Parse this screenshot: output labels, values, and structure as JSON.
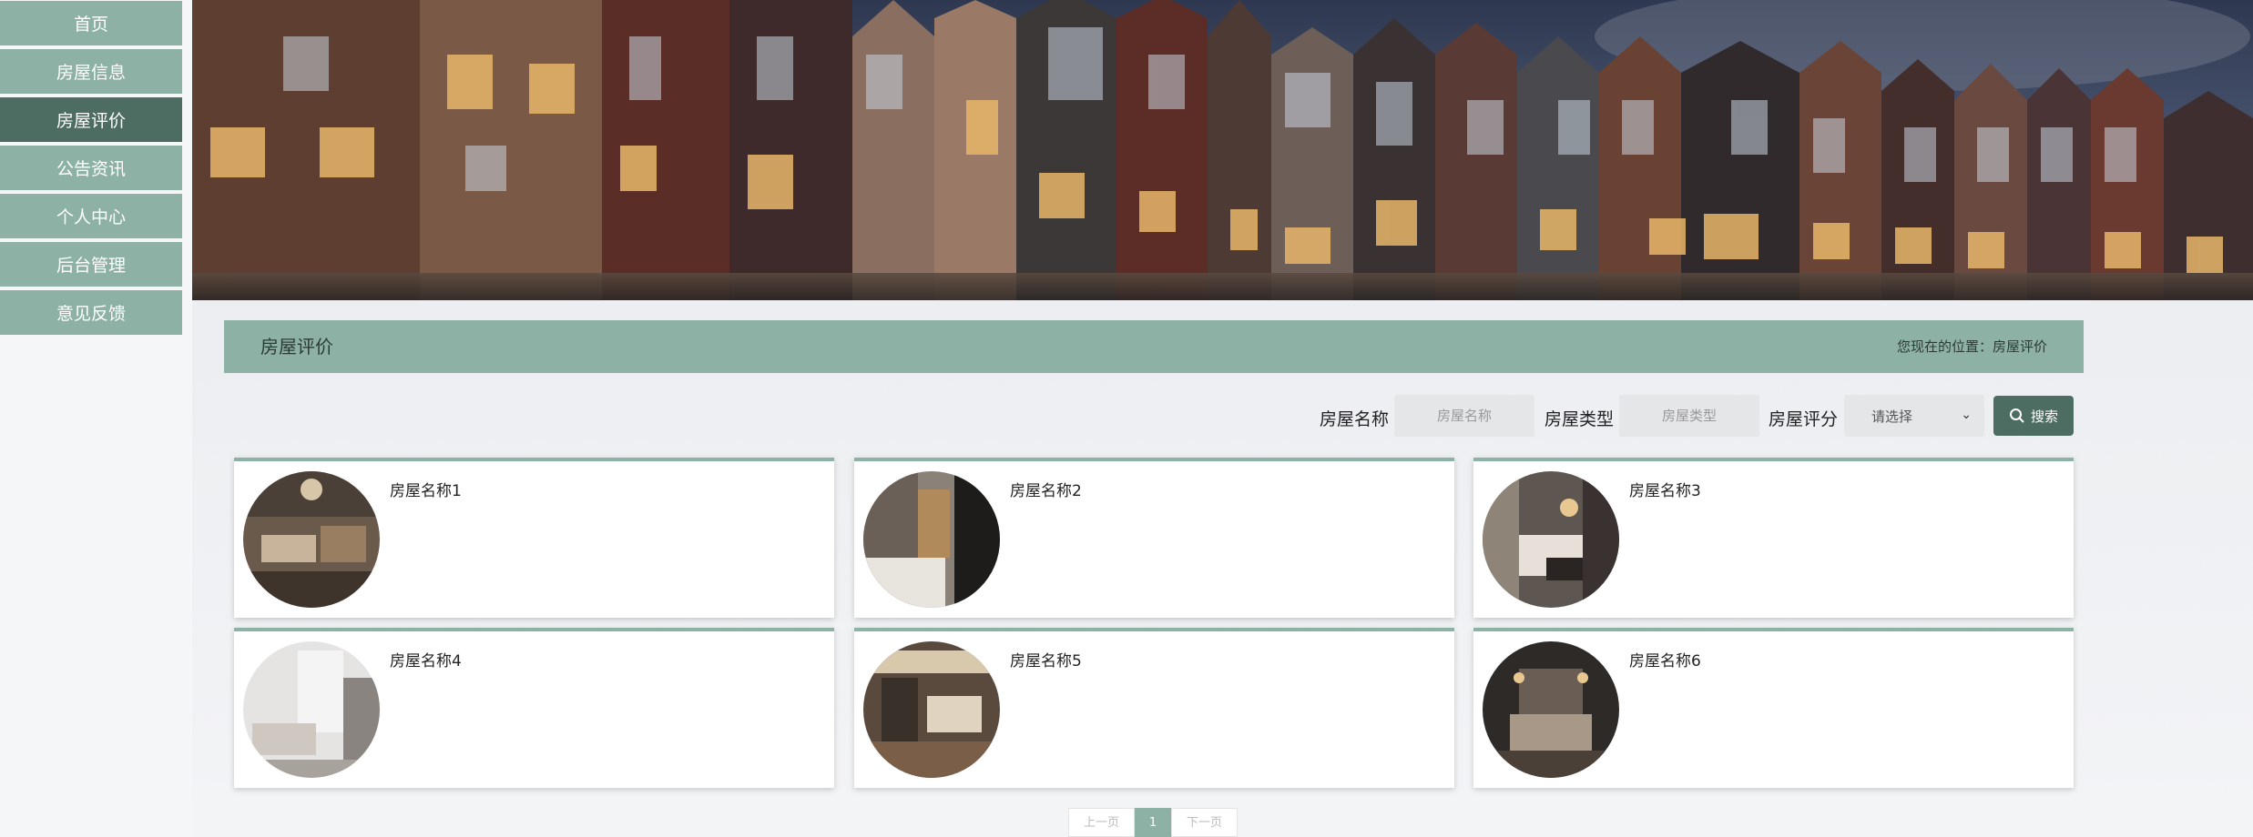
{
  "sidebar": {
    "items": [
      {
        "label": "首页"
      },
      {
        "label": "房屋信息"
      },
      {
        "label": "房屋评价",
        "active": true
      },
      {
        "label": "公告资讯"
      },
      {
        "label": "个人中心"
      },
      {
        "label": "后台管理"
      },
      {
        "label": "意见反馈"
      }
    ]
  },
  "header": {
    "title": "房屋评价",
    "location": "您现在的位置：房屋评价"
  },
  "search": {
    "name_label": "房屋名称",
    "name_placeholder": "房屋名称",
    "type_label": "房屋类型",
    "type_placeholder": "房屋类型",
    "rating_label": "房屋评分",
    "rating_selected": "请选择",
    "button_label": "搜索"
  },
  "cards": [
    {
      "name": "房屋名称1"
    },
    {
      "name": "房屋名称2"
    },
    {
      "name": "房屋名称3"
    },
    {
      "name": "房屋名称4"
    },
    {
      "name": "房屋名称5"
    },
    {
      "name": "房屋名称6"
    }
  ],
  "pagination": {
    "prev": "上一页",
    "current": "1",
    "next": "下一页"
  },
  "colors": {
    "accent": "#8db1a4",
    "accent_dark": "#4e6d62"
  }
}
